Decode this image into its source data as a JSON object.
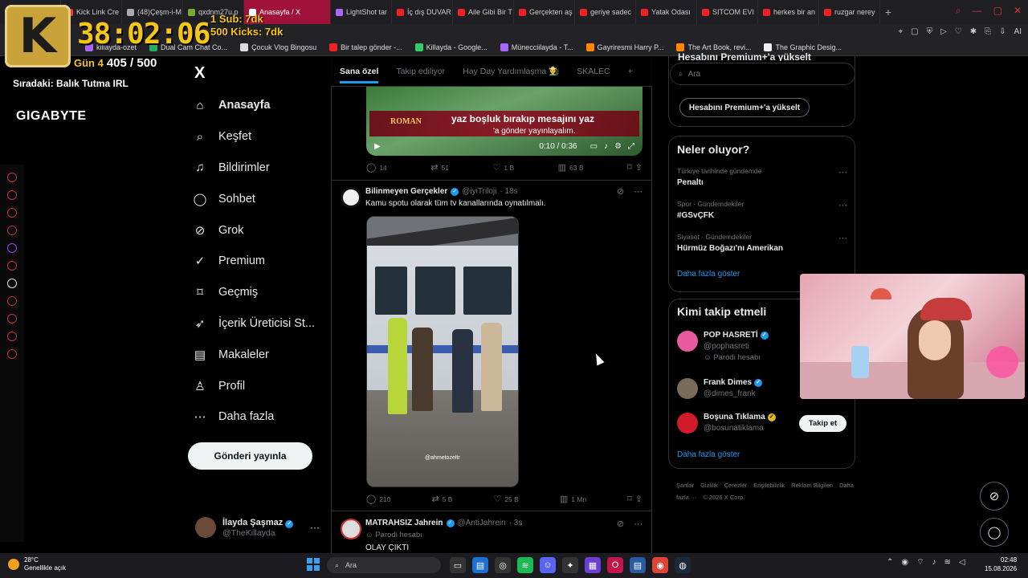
{
  "browser": {
    "tabs": [
      {
        "label": "eway",
        "color": "#555"
      },
      {
        "label": "Kick Link Cre",
        "color": "#e34"
      },
      {
        "label": "(48)Çeşm-i-M",
        "color": "#aaa"
      },
      {
        "label": "qxdnm27u.p",
        "color": "#7a3"
      },
      {
        "label": "Anasayfa / X",
        "color": "#fff",
        "active": true
      },
      {
        "label": "LightShot tar",
        "color": "#a6f"
      },
      {
        "label": "İç dış DUVAR",
        "color": "#e22"
      },
      {
        "label": "Aile Gibi Bir T",
        "color": "#e22"
      },
      {
        "label": "Gerçekten aş",
        "color": "#e22"
      },
      {
        "label": "geriye sadec",
        "color": "#e22"
      },
      {
        "label": "Yatak Odası",
        "color": "#e22"
      },
      {
        "label": "SITCOM EVI",
        "color": "#e22"
      },
      {
        "label": "herkes bir an",
        "color": "#e22"
      },
      {
        "label": "ruzgar nerey",
        "color": "#e22"
      }
    ],
    "new_tab": "+",
    "addr_right": "AI",
    "bookmarks": [
      {
        "label": "killayda-ozet",
        "color": "#a6f"
      },
      {
        "label": "Dual Cam Chat Co...",
        "color": "#2a6"
      },
      {
        "label": "Çocuk Vlog Bingosu",
        "color": "#ddd"
      },
      {
        "label": "Bir talep gönder -...",
        "color": "#e22"
      },
      {
        "label": "Killayda - Google...",
        "color": "#3c6"
      },
      {
        "label": "Münecciilayda - T...",
        "color": "#a6f"
      },
      {
        "label": "Gayriresmi Harry P...",
        "color": "#f80"
      },
      {
        "label": "The Art Book, revi...",
        "color": "#f80"
      },
      {
        "label": "The Graphic Desig...",
        "color": "#eee"
      }
    ]
  },
  "overlay": {
    "logo_letter": "K",
    "timer": "38:02:06",
    "sub_goal": "1 Sub: 7dk",
    "kick_goal": "500 Kicks: 7dk",
    "day_label": "Gün 4",
    "day_progress": "405 / 500",
    "next_label": "Sıradaki: Balık Tutma IRL",
    "sponsor": "GIGABYTE"
  },
  "nav": {
    "logo": "X",
    "items": [
      {
        "label": "Anasayfa",
        "icon": "home-icon",
        "glyph": "⌂"
      },
      {
        "label": "Keşfet",
        "icon": "search-icon",
        "glyph": "⌕"
      },
      {
        "label": "Bildirimler",
        "icon": "bell-icon",
        "glyph": "♫"
      },
      {
        "label": "Sohbet",
        "icon": "chat-icon",
        "glyph": "◯"
      },
      {
        "label": "Grok",
        "icon": "grok-icon",
        "glyph": "⊘"
      },
      {
        "label": "Premium",
        "icon": "premium-icon",
        "glyph": "✓"
      },
      {
        "label": "Geçmiş",
        "icon": "bookmark-icon",
        "glyph": "⌑"
      },
      {
        "label": "İçerik Üreticisi St...",
        "icon": "rocket-icon",
        "glyph": "➶"
      },
      {
        "label": "Makaleler",
        "icon": "article-icon",
        "glyph": "▤"
      },
      {
        "label": "Profil",
        "icon": "profile-icon",
        "glyph": "♙"
      },
      {
        "label": "Daha fazla",
        "icon": "more-icon",
        "glyph": "⋯"
      }
    ],
    "post_button": "Gönderi yayınla",
    "account_name": "İlayda Şaşmaz",
    "account_handle": "@TheKillayda",
    "account_more": "···"
  },
  "feed": {
    "tabs": [
      "Sana özel",
      "Takip ediliyor",
      "Hay Day Yardımlaşma 👨‍🌾",
      "SKALEC"
    ],
    "tab_add": "+",
    "video1": {
      "line1": "ROMAN",
      "line2": "yaz boşluk bırakıp mesajını yaz",
      "line3": "'a gönder yayınlayalım.",
      "time": "0:10 / 0:36"
    },
    "actions1": {
      "replies": "14",
      "reposts": "51",
      "likes": "1 B",
      "views": "63 B"
    },
    "tweet2": {
      "name": "Bilinmeyen Gerçekler",
      "handle": "@iyiTriloji",
      "time": "· 18s",
      "text": "Kamu spotu olarak tüm tv kanallarında oynatılmalı.",
      "watermark": "@ahmetozeltr",
      "replies": "210",
      "reposts": "5 B",
      "likes": "25 B",
      "views": "1 Mn"
    },
    "tweet3": {
      "name": "MATRAHSIZ Jahrein",
      "handle": "@AntiJahrein",
      "time": "· 3s",
      "parody": "Parodi hesabı",
      "text": "OLAY ÇIKTI"
    }
  },
  "right": {
    "premium_title": "Hesabını Premium+'a yükselt",
    "search_placeholder": "Ara",
    "upgrade_button": "Hesabını Premium+'a yükselt",
    "trends_title": "Neler oluyor?",
    "trends": [
      {
        "context": "Türkiye tarihinde gündemde",
        "name": "Penaltı"
      },
      {
        "context": "Spor · Gündemdekiler",
        "name": "#GSvÇFK"
      },
      {
        "context": "Siyaset · Gündemdekiler",
        "name": "Hürmüz Boğazı'nı Amerikan"
      }
    ],
    "trends_more": "Daha fazla göster",
    "who_title": "Kimi takip etmeli",
    "who": [
      {
        "name": "POP HASRETİ",
        "handle": "@pophasreti",
        "parody": "Parodi hesabı",
        "color": "#e85aa0"
      },
      {
        "name": "Frank Dimes",
        "handle": "@dimes_frank",
        "parody": "",
        "color": "#7a6a5a"
      },
      {
        "name": "Boşuna Tıklama",
        "handle": "@bosunatiklama",
        "parody": "",
        "color": "#d01a2a"
      }
    ],
    "follow_button": "Takip et",
    "who_more": "Daha fazla göster",
    "footer": [
      "Şartlar",
      "Gizlilik",
      "Çerezler",
      "Erişilebilirlik",
      "Reklam Bilgileri",
      "Daha fazla ···",
      "© 2026 X Corp."
    ]
  },
  "taskbar": {
    "temp": "28°C",
    "weather": "Genellikle açık",
    "search": "Ara",
    "time": "02:48",
    "date": "15.08.2026"
  }
}
